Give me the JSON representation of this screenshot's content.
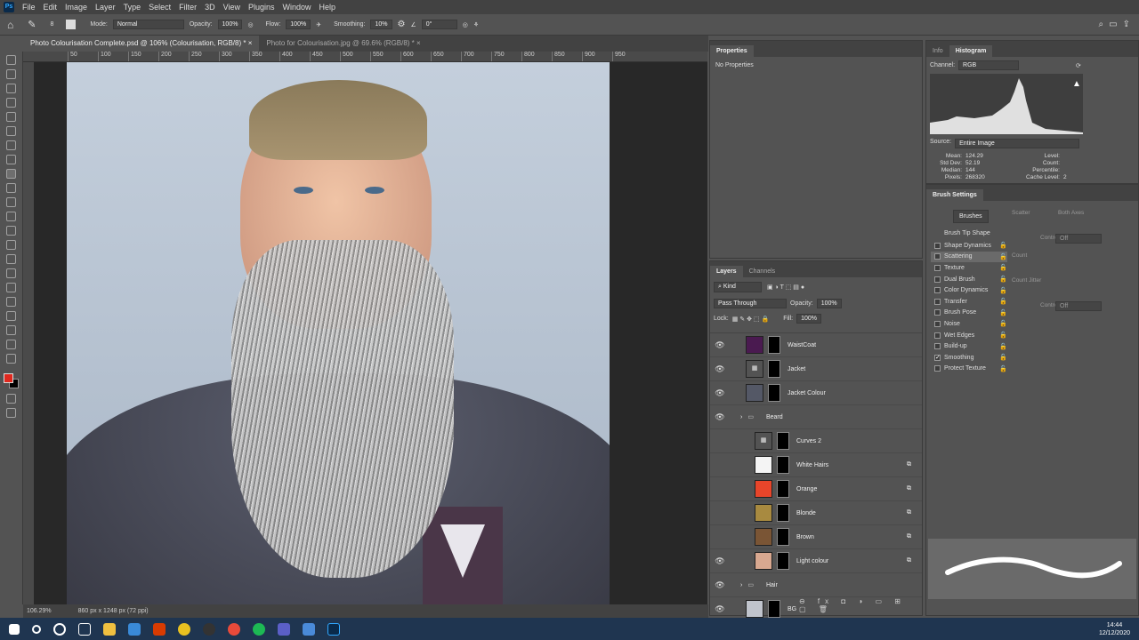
{
  "menu": {
    "app_logo": "Ps",
    "items": [
      "File",
      "Edit",
      "Image",
      "Layer",
      "Type",
      "Select",
      "Filter",
      "3D",
      "View",
      "Plugins",
      "Window",
      "Help"
    ]
  },
  "options": {
    "brush_size": "8",
    "mode_label": "Mode:",
    "mode": "Normal",
    "opacity_label": "Opacity:",
    "opacity": "100%",
    "flow_label": "Flow:",
    "flow": "100%",
    "smoothing_label": "Smoothing:",
    "smoothing": "10%",
    "angle": "0°"
  },
  "tabs": [
    {
      "label": "Photo Colourisation Complete.psd @ 106% (Colourisation, RGB/8) *"
    },
    {
      "label": "Photo for Colourisation.jpg @ 69.6% (RGB/8) *"
    }
  ],
  "ruler": [
    "50",
    "100",
    "150",
    "200",
    "250",
    "300",
    "350",
    "400",
    "450",
    "500",
    "550",
    "600",
    "650",
    "700",
    "750",
    "800",
    "850",
    "900",
    "950"
  ],
  "status": {
    "zoom": "106.29%",
    "doc_size": "860 px x 1248 px (72 ppi)"
  },
  "properties": {
    "title": "Properties",
    "content": "No Properties"
  },
  "histogram": {
    "tabs": [
      "Info",
      "Histogram"
    ],
    "channel_label": "Channel:",
    "channel": "RGB",
    "source_label": "Source:",
    "source": "Entire Image",
    "stats": [
      [
        "Mean:",
        "124.29",
        "Level:",
        ""
      ],
      [
        "Std Dev:",
        "52.19",
        "Count:",
        ""
      ],
      [
        "Median:",
        "144",
        "Percentile:",
        ""
      ],
      [
        "Pixels:",
        "268320",
        "Cache Level:",
        "2"
      ]
    ]
  },
  "brush_settings": {
    "title": "Brush Settings",
    "brushes_button": "Brushes",
    "tip_shape": "Brush Tip Shape",
    "scatter": "Scatter",
    "both_axes": "Both Axes",
    "control": "Control:",
    "off": "Off",
    "count": "Count",
    "count_jitter": "Count Jitter",
    "items": [
      {
        "label": "Shape Dynamics",
        "checked": false
      },
      {
        "label": "Scattering",
        "checked": false,
        "selected": true
      },
      {
        "label": "Texture",
        "checked": false
      },
      {
        "label": "Dual Brush",
        "checked": false
      },
      {
        "label": "Color Dynamics",
        "checked": false
      },
      {
        "label": "Transfer",
        "checked": false
      },
      {
        "label": "Brush Pose",
        "checked": false
      },
      {
        "label": "Noise",
        "checked": false
      },
      {
        "label": "Wet Edges",
        "checked": false
      },
      {
        "label": "Build-up",
        "checked": false
      },
      {
        "label": "Smoothing",
        "checked": true
      },
      {
        "label": "Protect Texture",
        "checked": false
      }
    ]
  },
  "layers": {
    "tabs": [
      "Layers",
      "Channels"
    ],
    "kind": "Kind",
    "blend": "Pass Through",
    "opacity_label": "Opacity:",
    "opacity": "100%",
    "lock_label": "Lock:",
    "fill_label": "Fill:",
    "fill": "100%",
    "items": [
      {
        "name": "WaistCoat",
        "visible": true,
        "indent": 0,
        "thumb": "#4a1a50",
        "type": "fill"
      },
      {
        "name": "Jacket",
        "visible": true,
        "indent": 0,
        "thumb": "",
        "type": "adjust"
      },
      {
        "name": "Jacket Colour",
        "visible": true,
        "indent": 0,
        "thumb": "#545866",
        "type": "fill"
      },
      {
        "name": "Beard",
        "visible": true,
        "indent": 0,
        "type": "group"
      },
      {
        "name": "Curves 2",
        "visible": false,
        "indent": 1,
        "thumb": "",
        "type": "adjust"
      },
      {
        "name": "White Hairs",
        "visible": false,
        "indent": 1,
        "thumb": "#f4f4f4",
        "type": "fill"
      },
      {
        "name": "Orange",
        "visible": false,
        "indent": 1,
        "thumb": "#e8452a",
        "type": "fill"
      },
      {
        "name": "Blonde",
        "visible": false,
        "indent": 1,
        "thumb": "#a88a40",
        "type": "fill"
      },
      {
        "name": "Brown",
        "visible": false,
        "indent": 1,
        "thumb": "#7a5535",
        "type": "fill"
      },
      {
        "name": "Light colour",
        "visible": true,
        "indent": 1,
        "thumb": "#d8a890",
        "type": "fill"
      },
      {
        "name": "Hair",
        "visible": true,
        "indent": 0,
        "type": "group"
      },
      {
        "name": "BG",
        "visible": true,
        "indent": 0,
        "thumb": "#c0c4cc",
        "type": "fill"
      }
    ]
  },
  "taskbar": {
    "time": "14:44",
    "date": "12/12/2020"
  },
  "colors": {
    "foreground": "#e0281e",
    "background": "#000000"
  }
}
